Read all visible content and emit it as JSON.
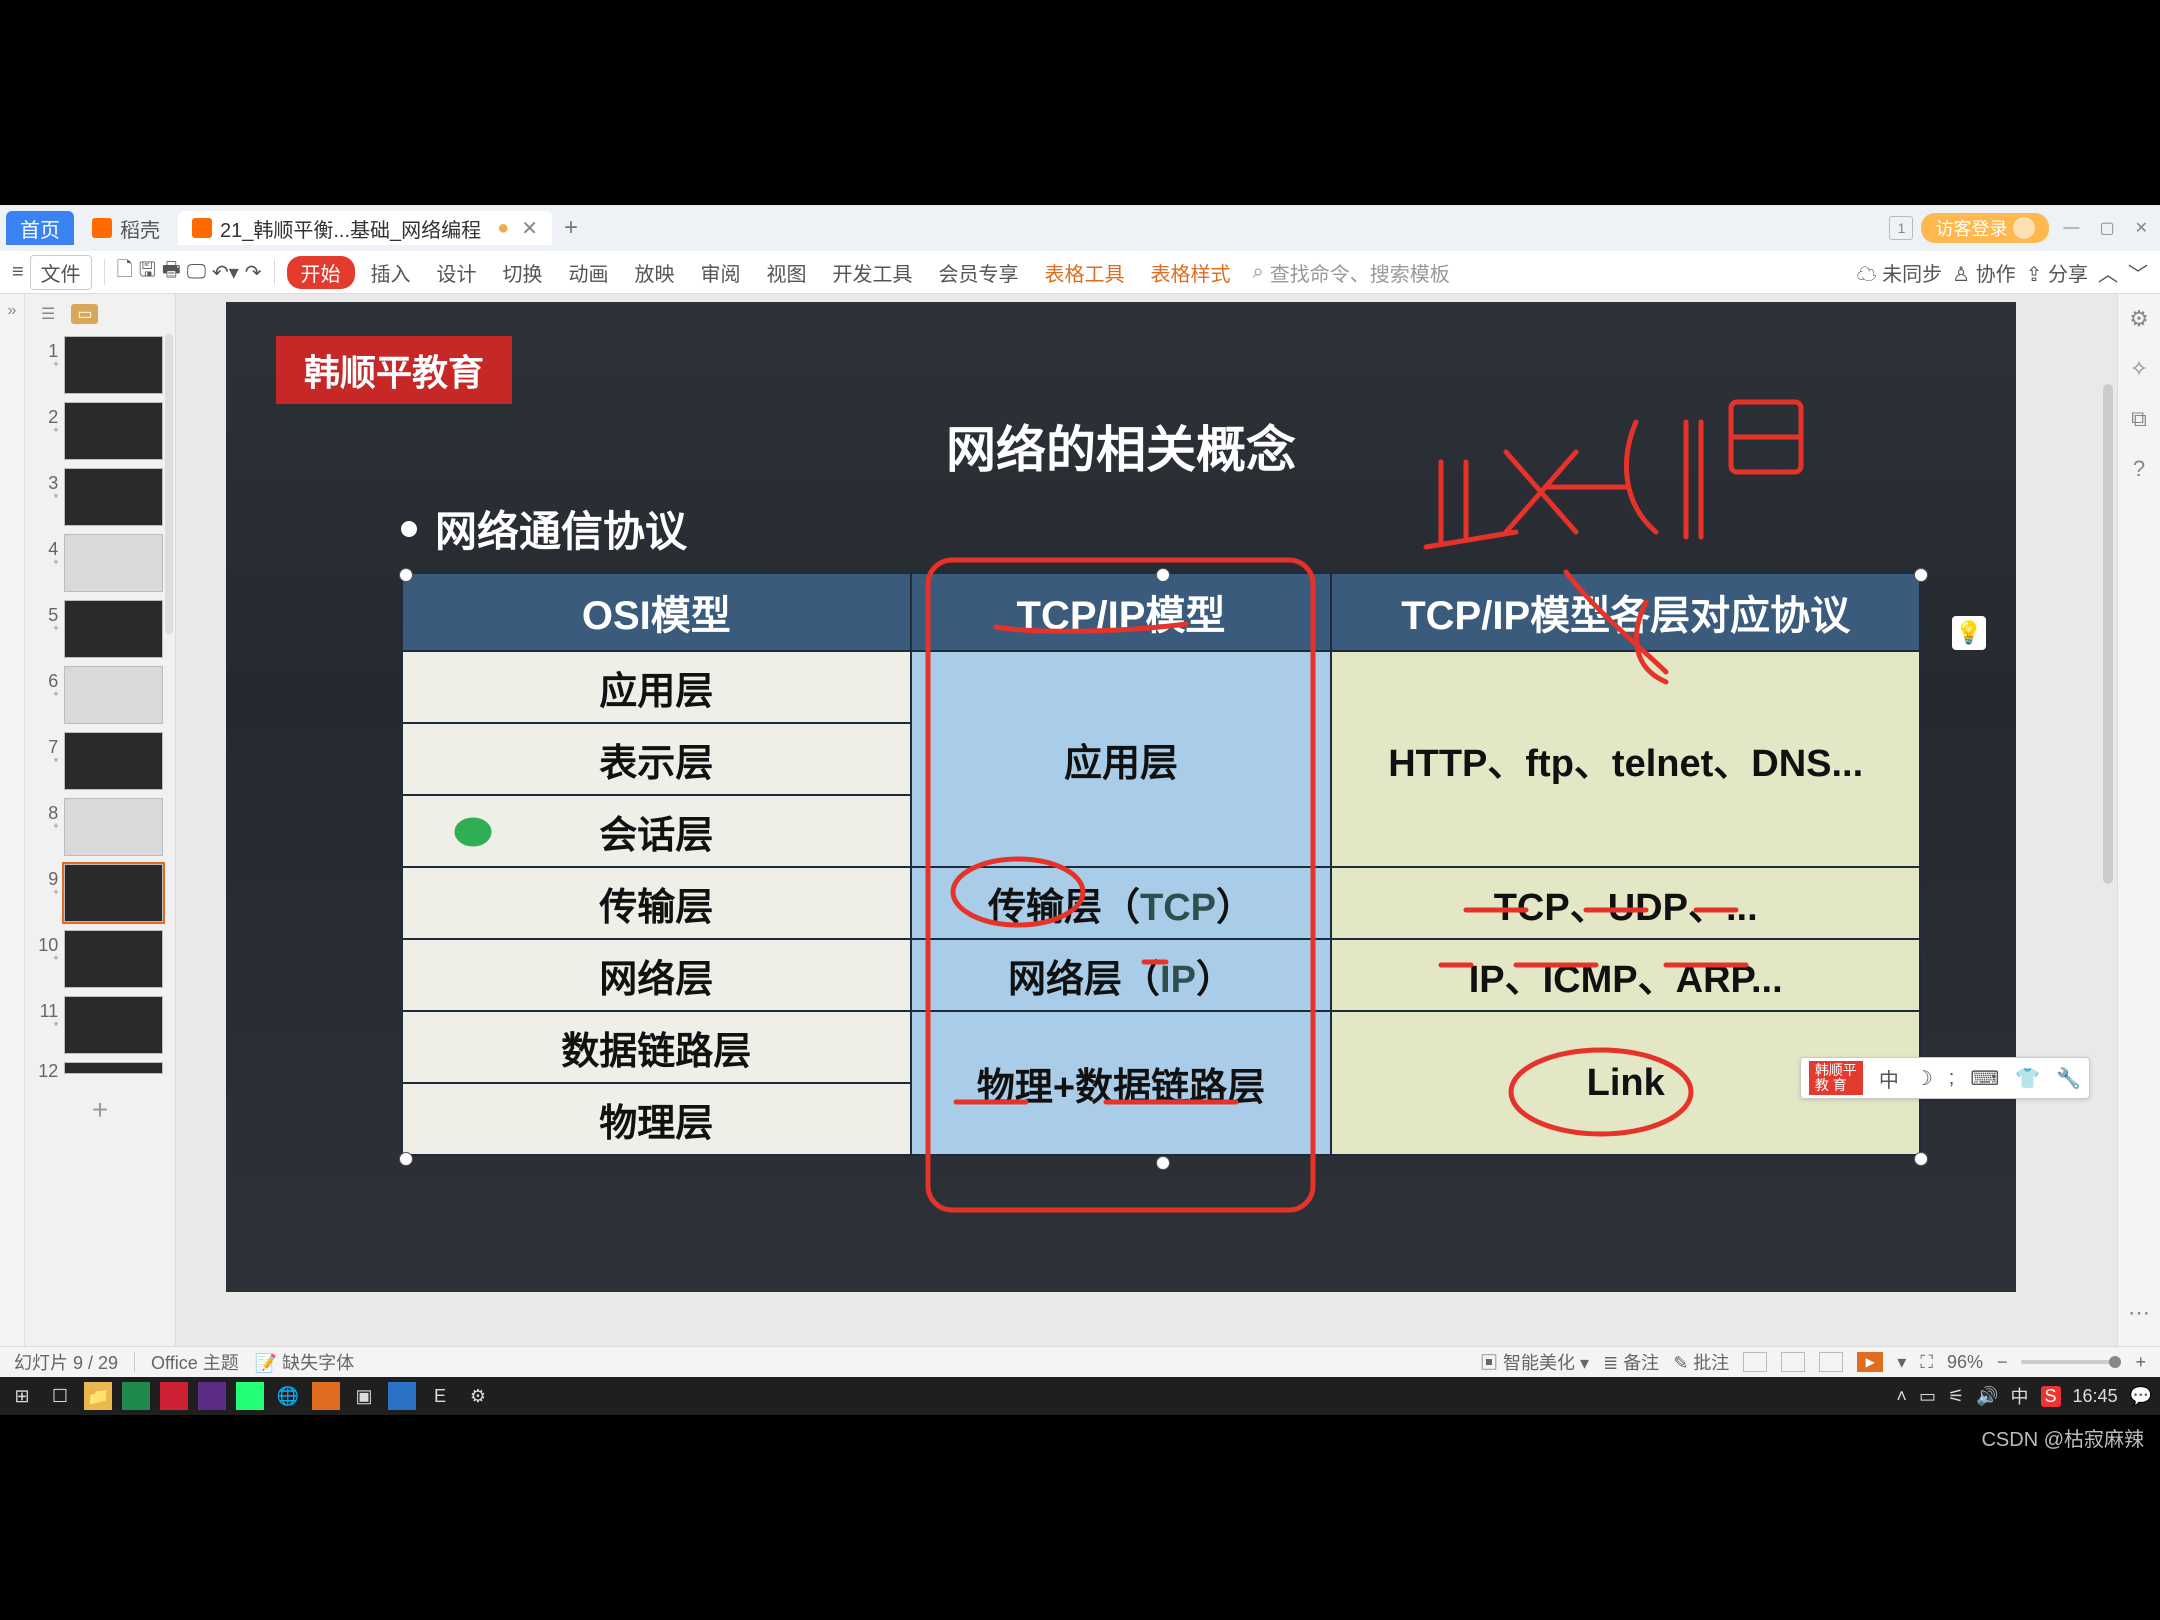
{
  "tabs": {
    "home": "首页",
    "docker": "稻壳",
    "file": "21_韩顺平衡...基础_网络编程"
  },
  "titlebar": {
    "visitor_login": "访客登录",
    "badge": "1"
  },
  "menu": {
    "file": "文件"
  },
  "ribbon": {
    "start": "开始",
    "insert": "插入",
    "design": "设计",
    "transition": "切换",
    "animation": "动画",
    "slideshow": "放映",
    "review": "审阅",
    "view": "视图",
    "dev": "开发工具",
    "member": "会员专享",
    "table_tools": "表格工具",
    "table_style": "表格样式",
    "search_placeholder": "查找命令、搜索模板",
    "unsynced": "未同步",
    "collab": "协作",
    "share": "分享"
  },
  "slide": {
    "brand": "韩顺平教育",
    "title": "网络的相关概念",
    "bullet": "网络通信协议",
    "headers": [
      "OSI模型",
      "TCP/IP模型",
      "TCP/IP模型各层对应协议"
    ],
    "osi": [
      "应用层",
      "表示层",
      "会话层",
      "传输层",
      "网络层",
      "数据链路层",
      "物理层"
    ],
    "mid_app": "应用层",
    "mid_transport": "传输层（",
    "mid_transport_tcp": "TCP",
    "mid_transport_tail": "）",
    "mid_network": "网络层（",
    "mid_network_ip": "IP",
    "mid_network_tail": "）",
    "mid_link": "物理+数据链路层",
    "proto_app": "HTTP、ftp、telnet、DNS...",
    "proto_transport": "TCP、UDP、...",
    "proto_network": "IP、ICMP、ARP...",
    "proto_link": "Link"
  },
  "ime": {
    "brand_top": "韩顺平",
    "brand_bottom": "教  育",
    "mode": "中"
  },
  "status": {
    "slide_counter": "幻灯片 9 / 29",
    "theme": "Office 主题",
    "missing_font": "缺失字体",
    "ai_beautify": "智能美化",
    "notes": "备注",
    "comments": "批注",
    "zoom": "96%"
  },
  "clock": "16:45",
  "watermark": "CSDN @枯寂麻辣"
}
